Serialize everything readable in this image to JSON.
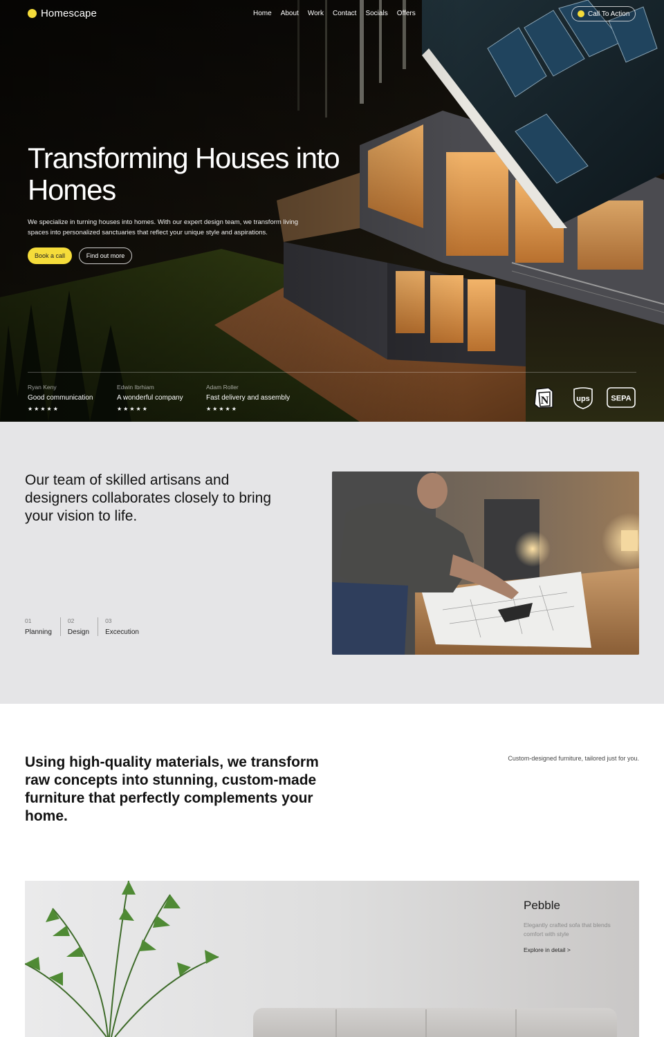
{
  "nav": {
    "brand": "Homescape",
    "items": [
      "Home",
      "About",
      "Work",
      "Contact",
      "Socials",
      "Offers"
    ],
    "cta": "Call To Action"
  },
  "hero": {
    "title": "Transforming Houses into Homes",
    "description": "We specialize in turning houses into homes. With our expert design team, we transform living spaces into personalized sanctuaries that reflect your unique style and aspirations.",
    "primary_button": "Book a call",
    "secondary_button": "Find out more",
    "reviews": [
      {
        "name": "Ryan Keny",
        "text": "Good communication",
        "stars": "★★★★★"
      },
      {
        "name": "Edwin Ibrhiam",
        "text": "A wonderful company",
        "stars": "★★★★★"
      },
      {
        "name": "Adam Roller",
        "text": "Fast delivery and assembly",
        "stars": "★★★★★"
      }
    ],
    "logos": [
      "notion-logo",
      "ups-logo",
      "sepa-logo"
    ]
  },
  "team": {
    "heading": "Our team of skilled artisans and designers collaborates closely to bring your vision to life.",
    "steps": [
      {
        "num": "01",
        "label": "Planning"
      },
      {
        "num": "02",
        "label": "Design"
      },
      {
        "num": "03",
        "label": "Excecution"
      }
    ]
  },
  "materials": {
    "heading": "Using high-quality materials, we transform raw concepts into stunning, custom-made furniture that perfectly complements your home.",
    "note": "Custom-designed furniture, tailored just for you."
  },
  "product": {
    "name": "Pebble",
    "description": "Elegantly crafted sofa that blends comfort with style",
    "link": "Explore in detail >"
  },
  "colors": {
    "accent": "#f5dc3a",
    "section_gray": "#e5e5e7"
  }
}
